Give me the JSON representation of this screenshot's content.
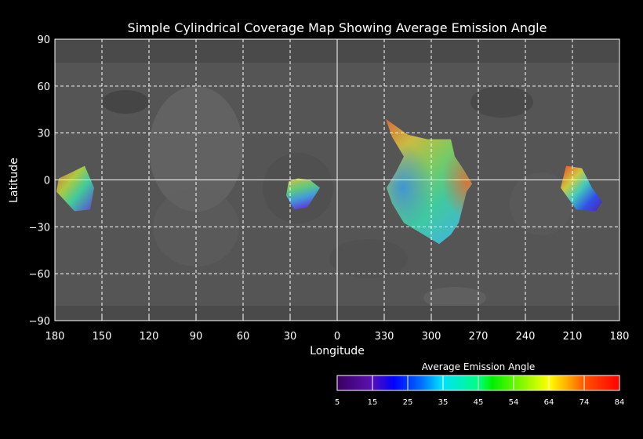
{
  "chart_data": {
    "type": "heatmap",
    "title": "Simple Cylindrical Coverage Map Showing Average Emission Angle",
    "xlabel": "Longitude",
    "ylabel": "Latitude",
    "x_tick_labels": [
      "180",
      "150",
      "120",
      "90",
      "60",
      "30",
      "0",
      "330",
      "300",
      "270",
      "240",
      "210",
      "180"
    ],
    "y_tick_labels": [
      "90",
      "60",
      "30",
      "0",
      "−30",
      "−60",
      "−90"
    ],
    "y_ticks": [
      90,
      60,
      30,
      0,
      -30,
      -60,
      -90
    ],
    "ylim": [
      -90,
      90
    ],
    "grid": true,
    "colorbar": {
      "title": "Average Emission Angle",
      "tick_labels": [
        "5",
        "15",
        "25",
        "35",
        "45",
        "54",
        "64",
        "74",
        "84"
      ],
      "range": [
        5,
        84
      ],
      "colors": [
        "#3a0060",
        "#5a10b0",
        "#0000ff",
        "#0090ff",
        "#00ffd0",
        "#00ff40",
        "#00e000",
        "#b0ff00",
        "#ffff00",
        "#ff9000",
        "#ff2000",
        "#ff0000"
      ]
    },
    "coverage_regions": [
      {
        "name": "region-lon-170",
        "emission_range": [
          15,
          60
        ],
        "points": [
          [
            177.5,
            1
          ],
          [
            169,
            5
          ],
          [
            161,
            9
          ],
          [
            155,
            -5
          ],
          [
            157.5,
            -19
          ],
          [
            167.5,
            -20
          ],
          [
            179,
            -7.5
          ]
        ]
      },
      {
        "name": "region-lon-20",
        "emission_range": [
          20,
          60
        ],
        "points": [
          [
            31,
            -1
          ],
          [
            25,
            1
          ],
          [
            17.5,
            0
          ],
          [
            11,
            -5
          ],
          [
            19,
            -17.5
          ],
          [
            27.5,
            -19
          ],
          [
            32.5,
            -10
          ]
        ]
      },
      {
        "name": "region-lon-300",
        "emission_range": [
          30,
          75
        ],
        "points": [
          [
            329,
            39
          ],
          [
            315,
            29
          ],
          [
            302.5,
            26
          ],
          [
            287.5,
            26
          ],
          [
            285,
            15
          ],
          [
            280,
            7.5
          ],
          [
            274,
            -2.5
          ],
          [
            277.5,
            -7.5
          ],
          [
            282.5,
            -27.5
          ],
          [
            287.5,
            -35
          ],
          [
            295,
            -41
          ],
          [
            305,
            -35
          ],
          [
            317.5,
            -27.5
          ],
          [
            325,
            -15
          ],
          [
            328.5,
            -5
          ],
          [
            322.5,
            5
          ],
          [
            317.5,
            15
          ],
          [
            325,
            27.5
          ]
        ]
      },
      {
        "name": "region-lon-205",
        "emission_range": [
          10,
          80
        ],
        "points": [
          [
            214,
            9
          ],
          [
            204,
            7.5
          ],
          [
            197.5,
            -5
          ],
          [
            191,
            -14
          ],
          [
            195,
            -20
          ],
          [
            207.5,
            -19
          ],
          [
            217.5,
            -5
          ]
        ]
      }
    ]
  }
}
